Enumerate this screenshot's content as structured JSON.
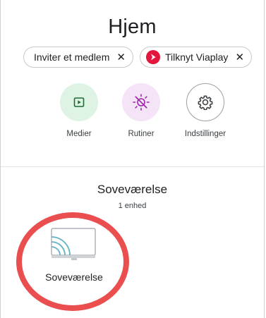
{
  "header": {
    "title": "Hjem"
  },
  "chips": [
    {
      "label": "Inviter et medlem",
      "close": "✕"
    },
    {
      "label": "Tilknyt Viaplay",
      "close": "✕"
    }
  ],
  "actions": [
    {
      "label": "Medier",
      "icon": "play-box-icon"
    },
    {
      "label": "Rutiner",
      "icon": "sun-off-icon"
    },
    {
      "label": "Indstillinger",
      "icon": "gear-icon"
    }
  ],
  "room": {
    "name": "Soveværelse",
    "device_count": "1 enhed",
    "devices": [
      {
        "label": "Soveværelse",
        "icon": "cast-display-icon"
      }
    ]
  },
  "colors": {
    "media_bg": "#dff3e4",
    "routines_bg": "#f5e3f7",
    "viaplay_red": "#e3173d",
    "highlight": "#ea4e4e",
    "cast_teal": "#5fb3c4"
  }
}
